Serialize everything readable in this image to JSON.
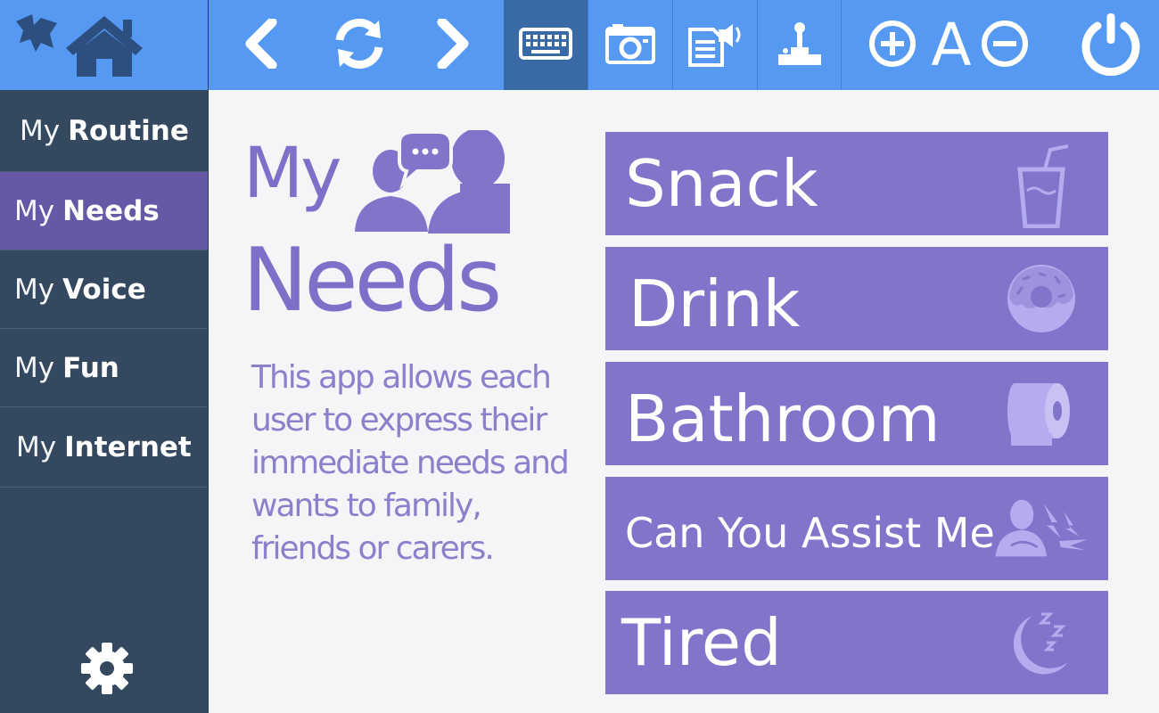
{
  "colors": {
    "toolbar": "#5599f2",
    "toolbar_active": "#3a6aa5",
    "sidebar": "#34485f",
    "sidebar_selected": "#6758a7",
    "accent": "#8075ca",
    "background": "#f4f5f7"
  },
  "toolbar": {
    "icons": [
      "butterfly-logo-icon",
      "home-icon",
      "back-icon",
      "refresh-icon",
      "forward-icon",
      "keyboard-icon",
      "camera-icon",
      "text-to-speech-icon",
      "joystick-icon",
      "zoom-in-icon",
      "font-size-icon",
      "zoom-out-icon",
      "power-icon"
    ],
    "font_label": "A",
    "active": "keyboard"
  },
  "sidebar": {
    "items": [
      {
        "prefix": "My",
        "name": "Routine",
        "selected": false
      },
      {
        "prefix": "My",
        "name": "Needs",
        "selected": true
      },
      {
        "prefix": "My",
        "name": "Voice",
        "selected": false
      },
      {
        "prefix": "My",
        "name": "Fun",
        "selected": false
      },
      {
        "prefix": "My",
        "name": "Internet",
        "selected": false
      }
    ]
  },
  "main": {
    "title_line1": "My",
    "title_line2": "Needs",
    "description": "This app allows each user to express their immediate needs and wants to family, friends or carers.",
    "needs": [
      {
        "label": "Snack",
        "icon": "drink-cup-icon"
      },
      {
        "label": "Drink",
        "icon": "donut-icon"
      },
      {
        "label": "Bathroom",
        "icon": "toilet-paper-icon"
      },
      {
        "label": "Can You Assist Me",
        "icon": "person-pain-icon"
      },
      {
        "label": "Tired",
        "icon": "moon-sleep-icon"
      }
    ]
  }
}
